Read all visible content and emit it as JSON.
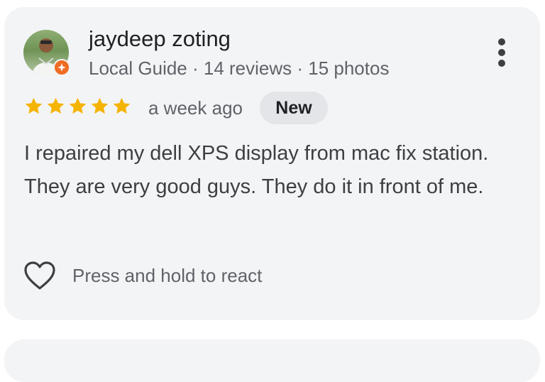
{
  "review": {
    "author_name": "jaydeep zoting",
    "author_meta": "Local Guide · 14 reviews · 15 photos",
    "rating": 5,
    "rating_max": 5,
    "time_ago": "a week ago",
    "new_badge": "New",
    "text": "I repaired my dell XPS display from mac fix station. They are very good guys. They do it in front of me.",
    "react_label": "Press and hold to react"
  },
  "icons": {
    "menu": "more-vert-icon",
    "heart": "heart-outline-icon",
    "star": "star-icon",
    "local_guide": "local-guide-badge-icon"
  },
  "colors": {
    "card_bg": "#f3f4f6",
    "star": "#f5b400",
    "badge_orange": "#f06c22",
    "new_chip_bg": "#e3e5e8"
  }
}
